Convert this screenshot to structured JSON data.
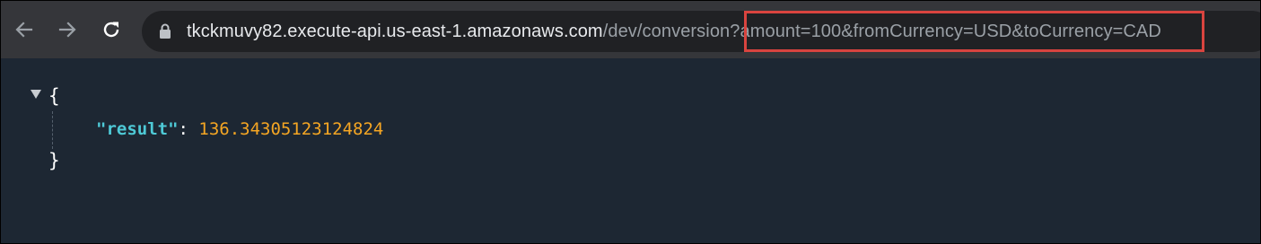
{
  "browser": {
    "url_host": "tkckmuvy82.execute-api.us-east-1.amazonaws.com",
    "url_path": "/dev/conversion",
    "url_query": "?amount=100&fromCurrency=USD&toCurrency=CAD",
    "icons": {
      "back": "arrow-left-icon",
      "forward": "arrow-right-icon",
      "reload": "reload-icon",
      "security": "lock-icon"
    },
    "highlight_color": "#d9443f"
  },
  "json_view": {
    "open_brace": "{",
    "close_brace": "}",
    "entries": [
      {
        "key": "\"result\"",
        "separator": ":",
        "value": "136.34305123124824"
      }
    ],
    "colors": {
      "background": "#1d2733",
      "key": "#4ec9d6",
      "number": "#f5a623",
      "punctuation": "#ffffff"
    }
  }
}
